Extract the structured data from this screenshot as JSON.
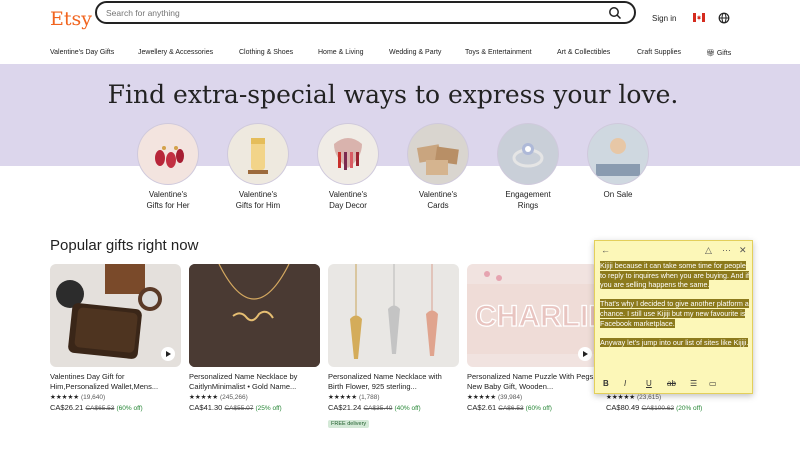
{
  "header": {
    "logo": "Etsy",
    "search_placeholder": "Search for anything",
    "sign_in": "Sign in"
  },
  "nav": [
    "Valentine's Day Gifts",
    "Jewellery & Accessories",
    "Clothing & Shoes",
    "Home & Living",
    "Wedding & Party",
    "Toys & Entertainment",
    "Art & Collectibles",
    "Craft Supplies",
    "Gifts"
  ],
  "hero": {
    "title": "Find extra-special ways to express your love."
  },
  "categories": [
    {
      "line1": "Valentine's",
      "line2": "Gifts for Her"
    },
    {
      "line1": "Valentine's",
      "line2": "Gifts for Him"
    },
    {
      "line1": "Valentine's",
      "line2": "Day Decor"
    },
    {
      "line1": "Valentine's",
      "line2": "Cards"
    },
    {
      "line1": "Engagement",
      "line2": "Rings"
    },
    {
      "line1": "On Sale",
      "line2": ""
    }
  ],
  "popular": {
    "title": "Popular gifts right now",
    "items": [
      {
        "title": "Valentines Day Gift for Him,Personalized Wallet,Mens...",
        "stars": "★★★★★",
        "count": "(19,640)",
        "price": "CA$26.21",
        "orig": "CA$65.53",
        "off": "(60% off)",
        "badge": ""
      },
      {
        "title": "Personalized Name Necklace by CaitlynMinimalist • Gold Name...",
        "stars": "★★★★★",
        "count": "(245,266)",
        "price": "CA$41.30",
        "orig": "CA$55.07",
        "off": "(25% off)",
        "badge": ""
      },
      {
        "title": "Personalized Name Necklace with Birth Flower, 925 sterling...",
        "stars": "★★★★★",
        "count": "(1,788)",
        "price": "CA$21.24",
        "orig": "CA$35.40",
        "off": "(40% off)",
        "badge": "FREE delivery"
      },
      {
        "title": "Personalized Name Puzzle With Pegs, New Baby Gift, Wooden...",
        "stars": "★★★★★",
        "count": "(39,984)",
        "price": "CA$2.61",
        "orig": "CA$6.53",
        "off": "(60% off)",
        "badge": ""
      },
      {
        "title": "",
        "stars": "★★★★★",
        "count": "(23,615)",
        "price": "CA$80.49",
        "orig": "CA$100.62",
        "off": "(20% off)",
        "badge": ""
      }
    ]
  },
  "sticky_note": {
    "paragraphs": [
      "Kijiji because it can take some time for people to reply to inquires when you are buying. And if you are selling happens the same.",
      "That's why I decided to give another platform a chance. I still use Kijiji but my new favourite is Facebook marketplace.",
      "Anyway let's jump into our list of sites like Kijiji."
    ]
  },
  "colors": {
    "brand": "#f1641e",
    "hero_band": "#dcd6ec",
    "note_bg": "#fcf7b8",
    "note_highlight": "#8c7a1c",
    "sale_green": "#258635"
  }
}
